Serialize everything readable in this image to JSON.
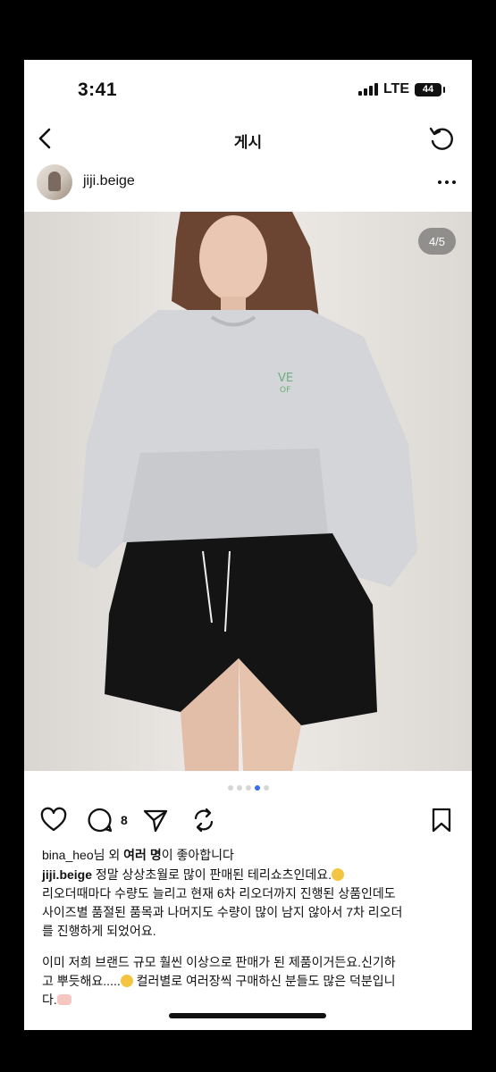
{
  "status": {
    "time": "3:41",
    "network": "LTE",
    "battery": "44"
  },
  "nav": {
    "title": "게시"
  },
  "post": {
    "username": "jiji.beige",
    "image_counter": "4/5",
    "image_index": 4,
    "image_total": 5,
    "comment_count": "8",
    "likes": {
      "user": "bina_heo",
      "mid": "님 외 ",
      "bold": "여러 명",
      "end": "이 좋아합니다"
    },
    "caption": {
      "user": "jiji.beige",
      "line1": " 정말 상상초월로 많이 판매된 테리쇼츠인데요.",
      "line2": "리오더때마다 수량도 늘리고 현재 6차 리오더까지 진행된 상품인데도",
      "line3": "사이즈별 품절된 품목과 나머지도 수량이 많이 남지 않아서 7차 리오더",
      "line4": "를 진행하게 되었어요.",
      "line5": "이미 저희 브랜드 규모 훨씬 이상으로 판매가 된 제품이거든요.신기하",
      "line6a": "고 뿌듯해요.....",
      "line6b": " 컬러별로 여러장씩 구매하신 분들도 많은 덕분입니",
      "line7": "다."
    }
  },
  "colors": {
    "dot_active": "#3b6cf4",
    "background": "#000000"
  }
}
